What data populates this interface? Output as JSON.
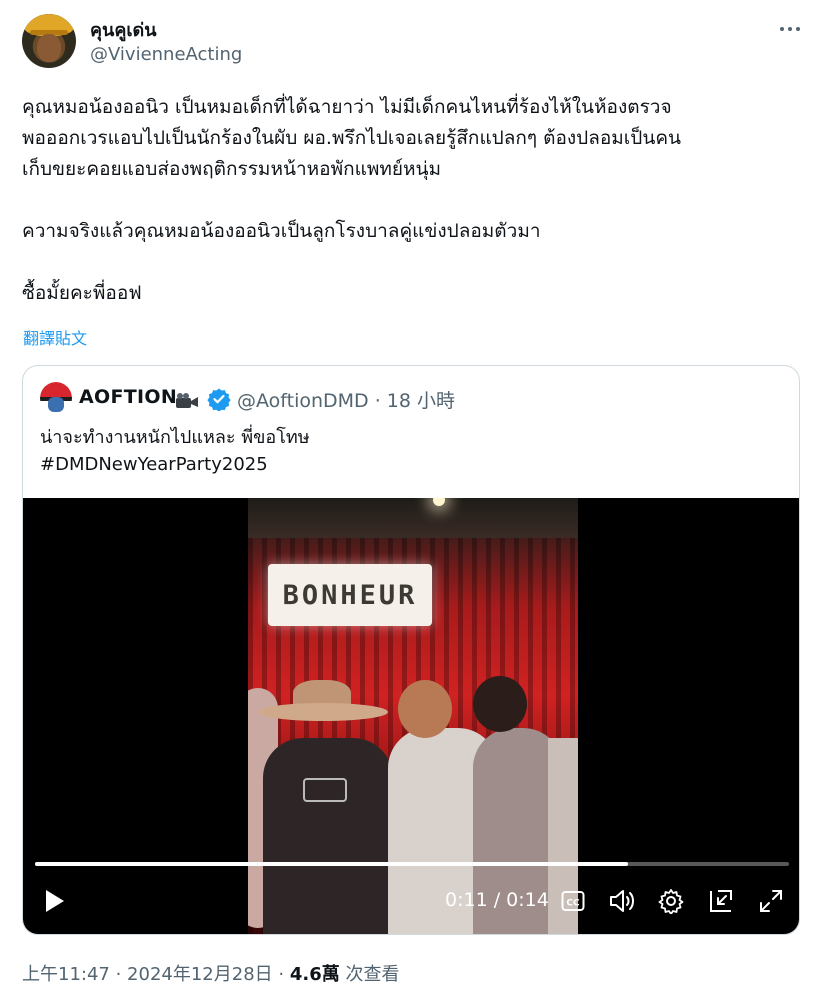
{
  "author": {
    "display_name": "คุนคูเด่น",
    "handle": "@VivienneActing"
  },
  "tweet": {
    "text": "คุณหมอน้องออนิว เป็นหมอเด็กที่ได้ฉายาว่า ไม่มีเด็กคนไหนที่ร้องไห้ในห้องตรวจ\nพอออกเวรแอบไปเป็นนักร้องในผับ ผอ.พรึกไปเจอเลยรู้สึกแปลกๆ ต้องปลอมเป็นคน\nเก็บขยะคอยแอบส่องพฤติกรรมหน้าหอพักแพทย์หนุ่ม\n\nความจริงแล้วคุณหมอน้องออนิวเป็นลูกโรงบาลคู่แข่งปลอมตัวมา\n\nซื้อมั้ยคะพี่ออฟ",
    "translate_label": "翻譯貼文"
  },
  "quote": {
    "display_name": "AOFTION",
    "handle_time": "@AoftionDMD · 18 小時",
    "text": "น่าจะทำงานหนักไปแหละ พี่ขอโทษ\n#DMDNewYearParty2025",
    "video": {
      "sign_text": "BONHEUR",
      "time_display": "0:11 / 0:14",
      "progress": 0.786
    }
  },
  "meta": {
    "timestamp": "上午11:47 · 2024年12月28日",
    "separator": " · ",
    "views_count": "4.6萬",
    "views_label": " 次查看"
  },
  "colors": {
    "accent": "#1d9bf0",
    "secondary_text": "#536471",
    "border": "#cfd9de"
  },
  "icons": [
    "more-icon",
    "camera-icon",
    "verified-badge-icon",
    "play-icon",
    "captions-icon",
    "volume-icon",
    "settings-icon",
    "pip-icon",
    "fullscreen-icon"
  ]
}
